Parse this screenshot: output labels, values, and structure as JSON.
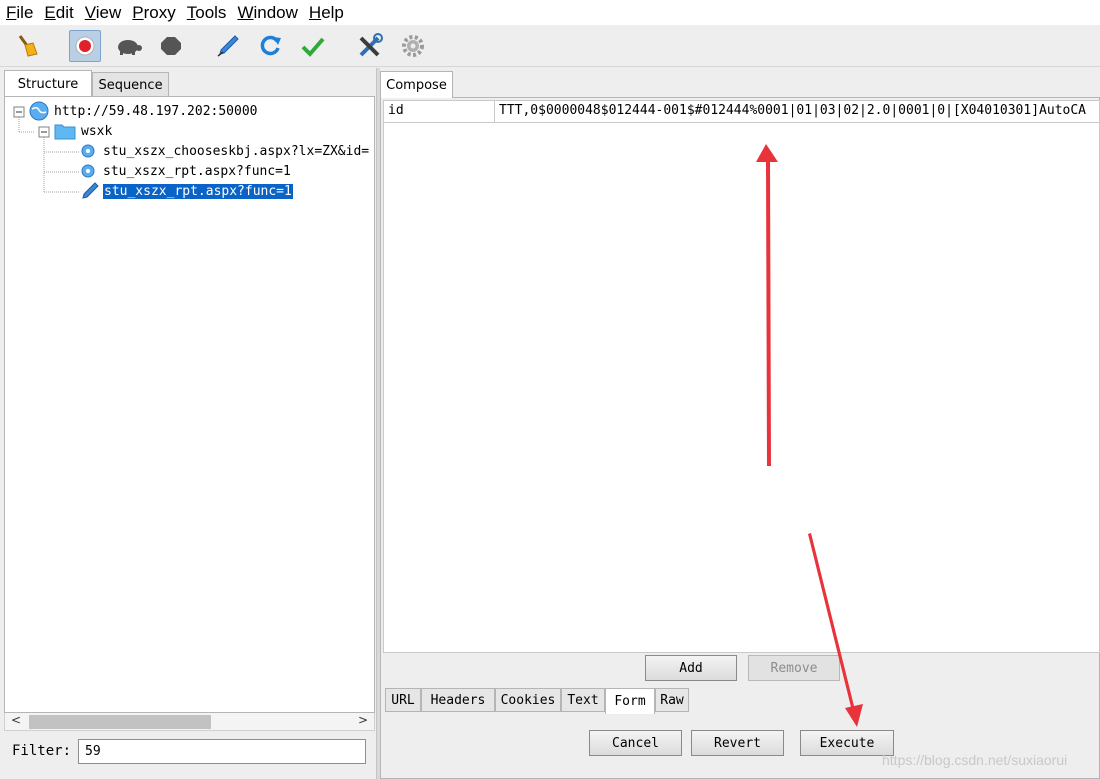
{
  "menu": {
    "items": [
      {
        "mnemonic": "F",
        "rest": "ile"
      },
      {
        "mnemonic": "E",
        "rest": "dit"
      },
      {
        "mnemonic": "V",
        "rest": "iew"
      },
      {
        "mnemonic": "P",
        "rest": "roxy"
      },
      {
        "mnemonic": "T",
        "rest": "ools"
      },
      {
        "mnemonic": "W",
        "rest": "indow"
      },
      {
        "mnemonic": "H",
        "rest": "elp"
      }
    ]
  },
  "toolbar": {
    "icons": [
      "broom-icon",
      "record-icon",
      "turtle-icon",
      "stop-icon",
      "compose-pen-icon",
      "repeat-icon",
      "validate-icon",
      "tools-icon",
      "settings-icon"
    ]
  },
  "left": {
    "tabs": [
      "Structure",
      "Sequence"
    ],
    "tree": {
      "host": "http://59.48.197.202:50000",
      "folder": "wsxk",
      "items": [
        "stu_xszx_chooseskbj.aspx?lx=ZX&id=",
        "stu_xszx_rpt.aspx?func=1",
        "stu_xszx_rpt.aspx?func=1"
      ]
    },
    "filter_label": "Filter:",
    "filter_value": "59"
  },
  "compose": {
    "tab": "Compose",
    "form_rows": [
      {
        "name": "id",
        "value": "TTT,0$0000048$012444-001$#012444%0001|01|03|02|2.0|0001|0|[X04010301]AutoCA"
      }
    ],
    "add_label": "Add",
    "remove_label": "Remove",
    "bottom_tabs": [
      "URL",
      "Headers",
      "Cookies",
      "Text",
      "Form",
      "Raw"
    ],
    "cancel_label": "Cancel",
    "revert_label": "Revert",
    "execute_label": "Execute"
  },
  "watermark": "https://blog.csdn.net/suxiaorui",
  "colors": {
    "selection": "#0a64c8",
    "arrow": "#e8333a",
    "record": "#e0202a"
  }
}
